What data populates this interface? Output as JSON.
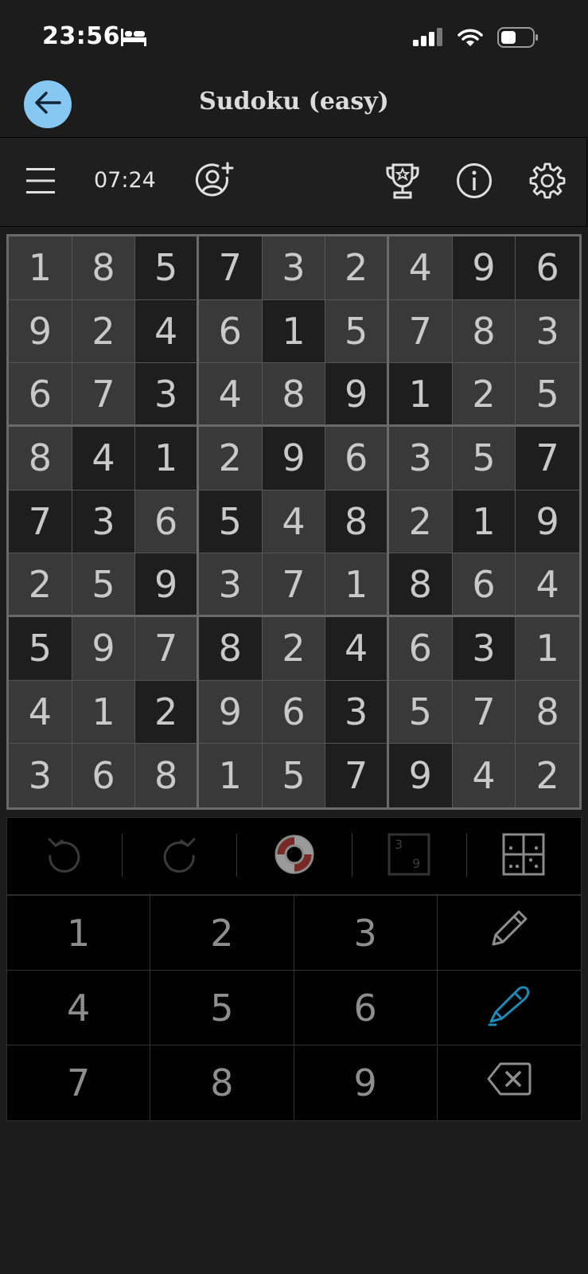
{
  "status_bar": {
    "time": "23:56"
  },
  "header": {
    "title": "Sudoku (easy)"
  },
  "toolbar": {
    "timer": "07:24"
  },
  "board": {
    "rows": [
      [
        "1",
        "8",
        "5",
        "7",
        "3",
        "2",
        "4",
        "9",
        "6"
      ],
      [
        "9",
        "2",
        "4",
        "6",
        "1",
        "5",
        "7",
        "8",
        "3"
      ],
      [
        "6",
        "7",
        "3",
        "4",
        "8",
        "9",
        "1",
        "2",
        "5"
      ],
      [
        "8",
        "4",
        "1",
        "2",
        "9",
        "6",
        "3",
        "5",
        "7"
      ],
      [
        "7",
        "3",
        "6",
        "5",
        "4",
        "8",
        "2",
        "1",
        "9"
      ],
      [
        "2",
        "5",
        "9",
        "3",
        "7",
        "1",
        "8",
        "6",
        "4"
      ],
      [
        "5",
        "9",
        "7",
        "8",
        "2",
        "4",
        "6",
        "3",
        "1"
      ],
      [
        "4",
        "1",
        "2",
        "9",
        "6",
        "3",
        "5",
        "7",
        "8"
      ],
      [
        "3",
        "6",
        "8",
        "1",
        "5",
        "7",
        "9",
        "4",
        "2"
      ]
    ],
    "dark_cells": [
      [
        0,
        0,
        1,
        1,
        0,
        0,
        0,
        1,
        1
      ],
      [
        0,
        0,
        1,
        0,
        1,
        0,
        0,
        0,
        0
      ],
      [
        0,
        0,
        1,
        0,
        0,
        1,
        1,
        0,
        0
      ],
      [
        0,
        1,
        1,
        0,
        1,
        0,
        0,
        0,
        1
      ],
      [
        1,
        1,
        0,
        1,
        0,
        1,
        0,
        1,
        1
      ],
      [
        0,
        0,
        1,
        0,
        0,
        0,
        1,
        0,
        0
      ],
      [
        1,
        0,
        0,
        1,
        0,
        1,
        0,
        1,
        0
      ],
      [
        0,
        0,
        1,
        0,
        0,
        1,
        0,
        0,
        0
      ],
      [
        0,
        0,
        0,
        0,
        0,
        1,
        1,
        0,
        0
      ]
    ]
  },
  "keypad": {
    "digits": [
      "1",
      "2",
      "3",
      "4",
      "5",
      "6",
      "7",
      "8",
      "9"
    ]
  },
  "colors": {
    "accent": "#87c8f2",
    "pen_active": "#1f8ab5"
  }
}
